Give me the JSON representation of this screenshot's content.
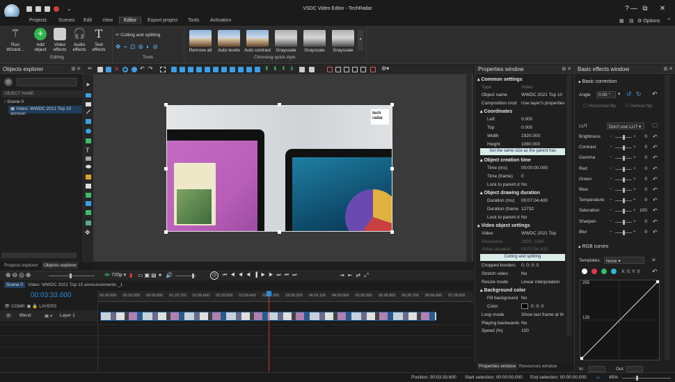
{
  "app": {
    "title": "VSDC Video Editor - TechRadar"
  },
  "window_controls": {
    "help": "?",
    "minimize": "—",
    "restore": "⧉",
    "close": "✕"
  },
  "menu": {
    "items": [
      "Projects",
      "Scenes",
      "Edit",
      "View",
      "Editor",
      "Export project",
      "Tools",
      "Activation"
    ],
    "active": "Editor",
    "options_label": "Options"
  },
  "ribbon": {
    "buttons": [
      {
        "label": "Run\nWizard...",
        "icon": "wand-icon"
      },
      {
        "label": "Add\nobject",
        "icon": "add-object-icon"
      },
      {
        "label": "Video\neffects",
        "icon": "video-effects-icon"
      },
      {
        "label": "Audio\neffects",
        "icon": "audio-effects-icon"
      },
      {
        "label": "Text\neffects",
        "icon": "text-effects-icon"
      }
    ],
    "editing_group": "Editing",
    "tools_header": "Cutting and splitting",
    "tools_group": "Tools",
    "quick_styles": [
      "Remove all",
      "Auto levels",
      "Auto contrast",
      "Grayscale",
      "Grayscale",
      "Grayscale"
    ],
    "quick_style_group": "Choosing quick style"
  },
  "objects_explorer": {
    "title": "Objects explorer",
    "column": "OBJECT NAME",
    "tree": [
      "Scene 0",
      "Video: WWDC 2021  Top 10 announ"
    ],
    "tabs": [
      "Projects explorer",
      "Objects explorer"
    ]
  },
  "preview": {
    "watermark_line1": "tech",
    "watermark_line2": "radar"
  },
  "playback": {
    "resolution": "720p"
  },
  "timeline": {
    "tabs": [
      "Scene 0",
      "Video: WWDC 2021  Top 10 announcements _1"
    ],
    "timecode": "00:03:33.600",
    "ruler": [
      "00:00.000",
      "00:29.900",
      "00:59.800",
      "01:29.700",
      "01:59.600",
      "02:29.500",
      "02:59.400",
      "03:29.300",
      "03:59.200",
      "04:29.100",
      "04:59.000",
      "05:28.900",
      "05:58.800",
      "06:28.700",
      "06:58.600",
      "07:28.500"
    ],
    "comp_label": "COMP.",
    "layers_label": "LAYERS",
    "blend_label": "Blend",
    "layer_label": "Layer 1"
  },
  "properties": {
    "title": "Properties window",
    "common_settings": "Common settings",
    "type_label": "Type",
    "type_value": "Video",
    "object_name_label": "Object name",
    "object_name_value": "WWDC 2021  Top 10",
    "composition_label": "Composition mod",
    "composition_value": "Use layer's properties",
    "coordinates": "Coordinates",
    "left_label": "Left",
    "left_value": "0.000",
    "top_label": "Top",
    "top_value": "0.000",
    "width_label": "Width",
    "width_value": "1920.000",
    "height_label": "Height",
    "height_value": "1080.000",
    "same_size_btn": "Set the same size as the parent has",
    "creation_time": "Object creation time",
    "time_ms_label": "Time (ms)",
    "time_ms_value": "00:00:00.000",
    "time_frame_label": "Time (frame)",
    "time_frame_value": "0",
    "lock1_label": "Lock to parent d",
    "lock1_value": "No",
    "drawing_duration": "Object drawing duration",
    "duration_ms_label": "Duration (ms)",
    "duration_ms_value": "00:07:04.400",
    "duration_frames_label": "Duration (frame",
    "duration_frames_value": "12732",
    "lock2_label": "Lock to parent d",
    "lock2_value": "No",
    "video_settings": "Video object settings",
    "video_label": "Video",
    "video_value": "WWDC 2021  Top",
    "resolution_label": "Resolution",
    "resolution_value": "1920; 1080",
    "video_duration_label": "Video duration",
    "video_duration_value": "00:07:04.400",
    "cutting_btn": "Cutting and splitting",
    "cropped_label": "Cropped borders",
    "cropped_value": "0; 0; 0; 0",
    "stretch_label": "Stretch video",
    "stretch_value": "No",
    "resize_label": "Resize mode",
    "resize_value": "Linear interpolation",
    "bg_color": "Background color",
    "fill_label": "Fill background",
    "fill_value": "No",
    "color_label": "Color",
    "color_value": "0; 0; 0",
    "loop_label": "Loop mode",
    "loop_value": "Show last frame at th",
    "playing_back_label": "Playing backwards",
    "playing_back_value": "No",
    "speed_label": "Speed (%)",
    "speed_value": "100",
    "tabs": [
      "Properties window",
      "Resources window"
    ]
  },
  "basic_effects": {
    "title": "Basic effects window",
    "basic_correction": "Basic correction",
    "angle_label": "Angle",
    "angle_value": "0.00 °",
    "hflip": "Horizontal flip",
    "vflip": "Vertical flip",
    "lut_label": "LUT",
    "lut_value": "Don't use LUT",
    "sliders": [
      {
        "name": "Brightness",
        "value": "0",
        "level": 0.5
      },
      {
        "name": "Contrast",
        "value": "0",
        "level": 0.5
      },
      {
        "name": "Gamma",
        "value": "0",
        "level": 0.5
      },
      {
        "name": "Red",
        "value": "0",
        "level": 0.5
      },
      {
        "name": "Green",
        "value": "0",
        "level": 0.5
      },
      {
        "name": "Blue",
        "value": "0",
        "level": 0.5
      },
      {
        "name": "Temperature",
        "value": "0",
        "level": 0.5
      },
      {
        "name": "Saturation",
        "value": "100",
        "level": 0.5
      },
      {
        "name": "Sharpen",
        "value": "0",
        "level": 0.5
      },
      {
        "name": "Blur",
        "value": "0",
        "level": 0.5
      }
    ],
    "rgb_curves": "RGB curves",
    "templates_label": "Templates:",
    "templates_value": "None",
    "xy_readout": "X: 0, Y: 0",
    "curve_top": "255",
    "curve_mid": "128",
    "in_label": "In:",
    "out_label": "Out:"
  },
  "statusbar": {
    "position_label": "Position:",
    "position_value": "00:03:33.600",
    "start_label": "Start selection:",
    "start_value": "00:00:00.000",
    "end_label": "End selection:",
    "end_value": "00:00:00.000",
    "zoom": "45%"
  },
  "colors": {
    "accent": "#2d89d6",
    "selection": "#1f3d5e",
    "timeline_playhead": "#d23a3a"
  }
}
